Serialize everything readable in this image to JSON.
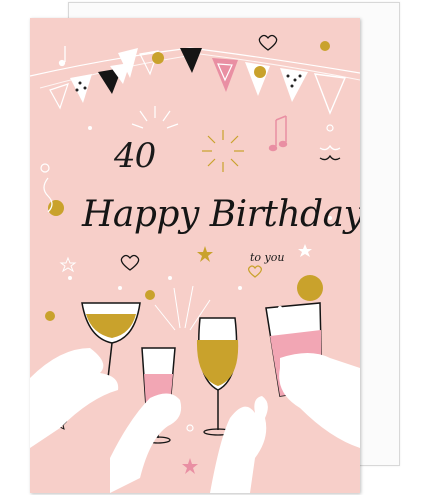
{
  "card": {
    "age": "40",
    "greeting": "Happy Birthday",
    "subtitle": "to you"
  },
  "colors": {
    "card_background": "#f7cfc9",
    "gold": "#c9a22c",
    "pink": "#e98fa3",
    "ink": "#151515",
    "envelope": "#fbfbfb"
  },
  "icons": [
    "bunting-flags",
    "sparkle-burst",
    "music-note-icon",
    "heart-icon",
    "star-icon",
    "gold-glitter-dot",
    "champagne-glass",
    "cocktail-glass",
    "toasting-hands"
  ]
}
